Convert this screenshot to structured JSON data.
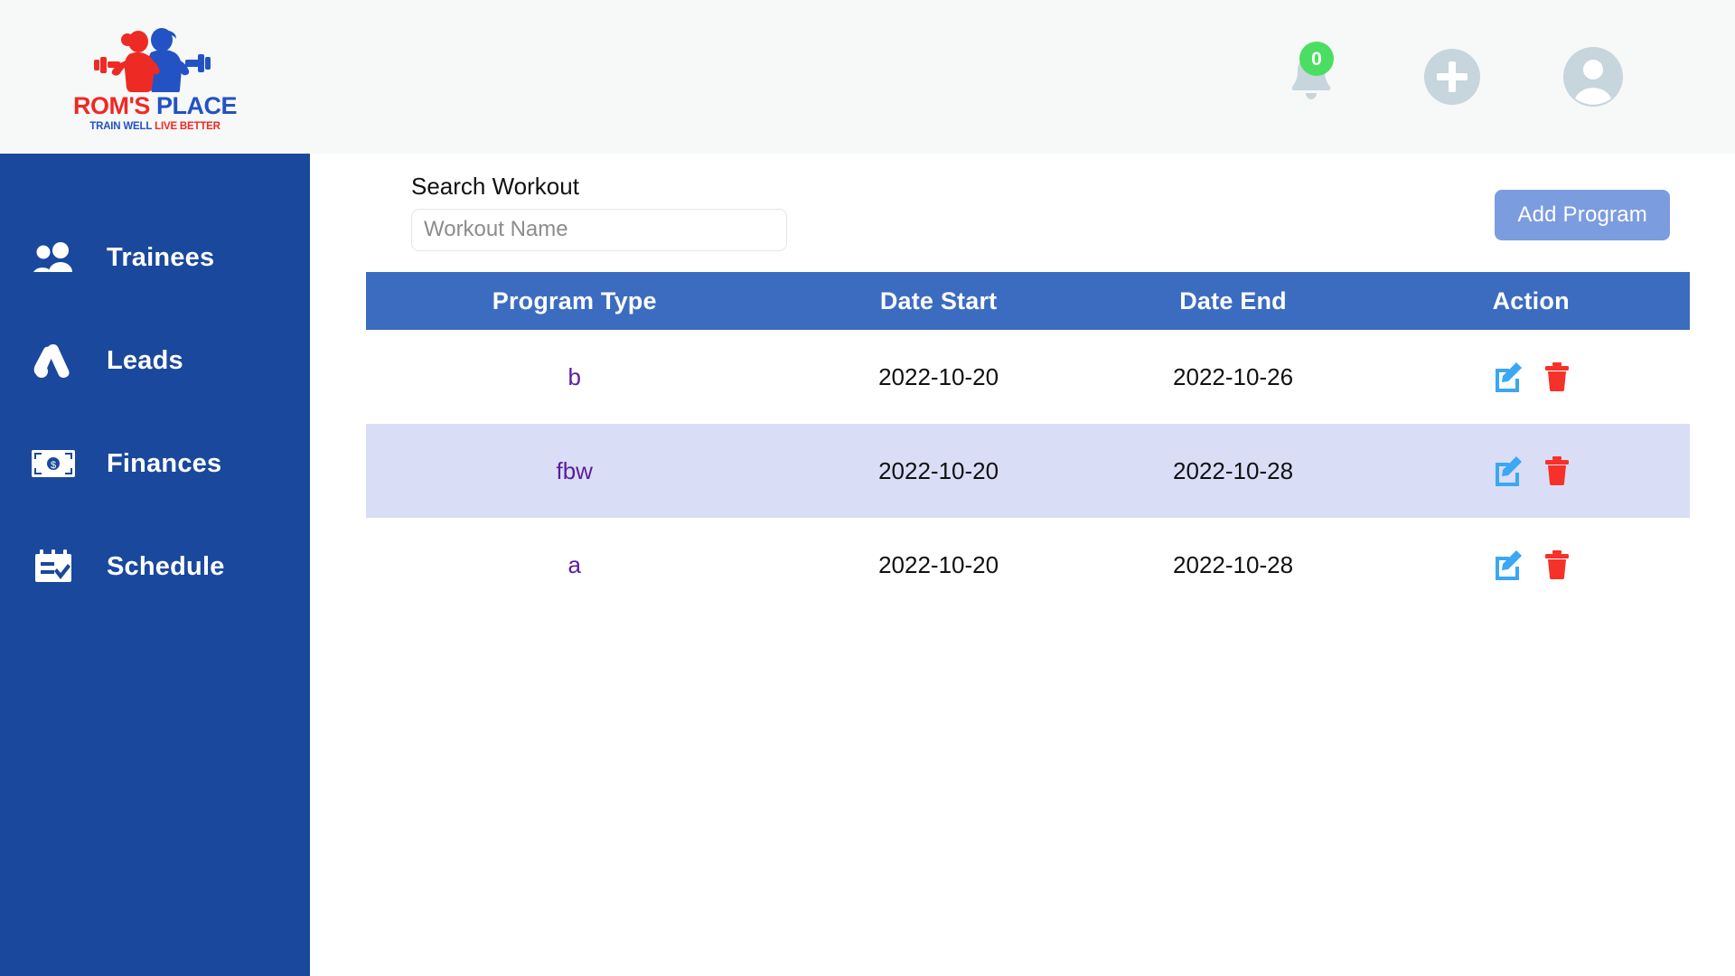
{
  "brand": {
    "word_first": "ROM'S",
    "word_second": "PLACE",
    "tagline_first": "TRAIN WELL",
    "tagline_second": "LIVE BETTER",
    "colors": {
      "red": "#ee2a24",
      "blue": "#2352c4"
    }
  },
  "topbar": {
    "background": "#f7f8f8",
    "notifications": {
      "icon": "bell-icon",
      "count": "0",
      "badge_color": "#4ade62"
    },
    "add": {
      "icon": "plus-circle-icon"
    },
    "profile": {
      "icon": "user-avatar-icon"
    }
  },
  "sidebar": {
    "background": "#1a489c",
    "items": [
      {
        "label": "Trainees",
        "icon": "people-icon"
      },
      {
        "label": "Leads",
        "icon": "ads-funnel-icon"
      },
      {
        "label": "Finances",
        "icon": "money-bill-icon"
      },
      {
        "label": "Schedule",
        "icon": "calendar-check-icon"
      }
    ]
  },
  "toolbar": {
    "search_label": "Search Workout",
    "search_placeholder": "Workout Name",
    "search_value": "",
    "add_program_label": "Add Program",
    "add_program_color": "#7c9ce0"
  },
  "table": {
    "header_color": "#3c6cc0",
    "alt_row_color": "#d9deF6",
    "columns": [
      "Program Type",
      "Date Start",
      "Date End",
      "Action"
    ],
    "rows": [
      {
        "program_type": "b",
        "date_start": "2022-10-20",
        "date_end": "2022-10-26",
        "edit_icon": "edit-pencil-icon",
        "delete_icon": "trash-icon"
      },
      {
        "program_type": "fbw",
        "date_start": "2022-10-20",
        "date_end": "2022-10-28",
        "edit_icon": "edit-pencil-icon",
        "delete_icon": "trash-icon"
      },
      {
        "program_type": "a",
        "date_start": "2022-10-20",
        "date_end": "2022-10-28",
        "edit_icon": "edit-pencil-icon",
        "delete_icon": "trash-icon"
      }
    ]
  }
}
